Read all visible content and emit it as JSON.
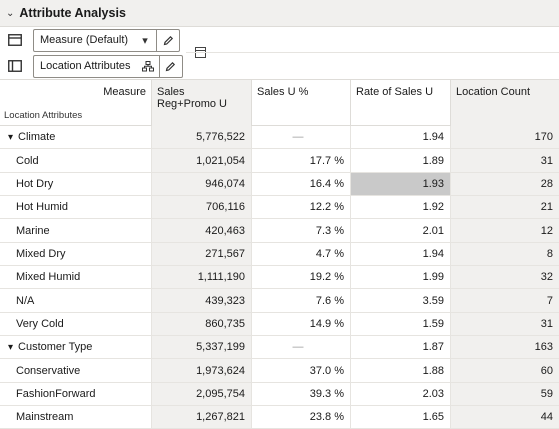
{
  "panel": {
    "title": "Attribute Analysis"
  },
  "toolbar": {
    "measure_selector": "Measure (Default)",
    "location_selector": "Location Attributes"
  },
  "grid": {
    "corner_measure": "Measure",
    "corner_row_label": "Location Attributes",
    "columns": [
      "Sales Reg+Promo U",
      "Sales U %",
      "Rate of Sales U",
      "Location Count"
    ],
    "rows": [
      {
        "label": "Climate",
        "group": true,
        "values": [
          "5,776,522",
          "—",
          "1.94",
          "170"
        ]
      },
      {
        "label": "Cold",
        "group": false,
        "values": [
          "1,021,054",
          "17.7 %",
          "1.89",
          "31"
        ]
      },
      {
        "label": "Hot Dry",
        "group": false,
        "values": [
          "946,074",
          "16.4 %",
          "1.93",
          "28"
        ]
      },
      {
        "label": "Hot Humid",
        "group": false,
        "values": [
          "706,116",
          "12.2 %",
          "1.92",
          "21"
        ]
      },
      {
        "label": "Marine",
        "group": false,
        "values": [
          "420,463",
          "7.3 %",
          "2.01",
          "12"
        ]
      },
      {
        "label": "Mixed Dry",
        "group": false,
        "values": [
          "271,567",
          "4.7 %",
          "1.94",
          "8"
        ]
      },
      {
        "label": "Mixed Humid",
        "group": false,
        "values": [
          "1,111,190",
          "19.2 %",
          "1.99",
          "32"
        ]
      },
      {
        "label": "N/A",
        "group": false,
        "values": [
          "439,323",
          "7.6 %",
          "3.59",
          "7"
        ]
      },
      {
        "label": "Very Cold",
        "group": false,
        "values": [
          "860,735",
          "14.9 %",
          "1.59",
          "31"
        ]
      },
      {
        "label": "Customer Type",
        "group": true,
        "values": [
          "5,337,199",
          "—",
          "1.87",
          "163"
        ]
      },
      {
        "label": "Conservative",
        "group": false,
        "values": [
          "1,973,624",
          "37.0 %",
          "1.88",
          "60"
        ]
      },
      {
        "label": "FashionForward",
        "group": false,
        "values": [
          "2,095,754",
          "39.3 %",
          "2.03",
          "59"
        ]
      },
      {
        "label": "Mainstream",
        "group": false,
        "values": [
          "1,267,821",
          "23.8 %",
          "1.65",
          "44"
        ]
      }
    ]
  }
}
